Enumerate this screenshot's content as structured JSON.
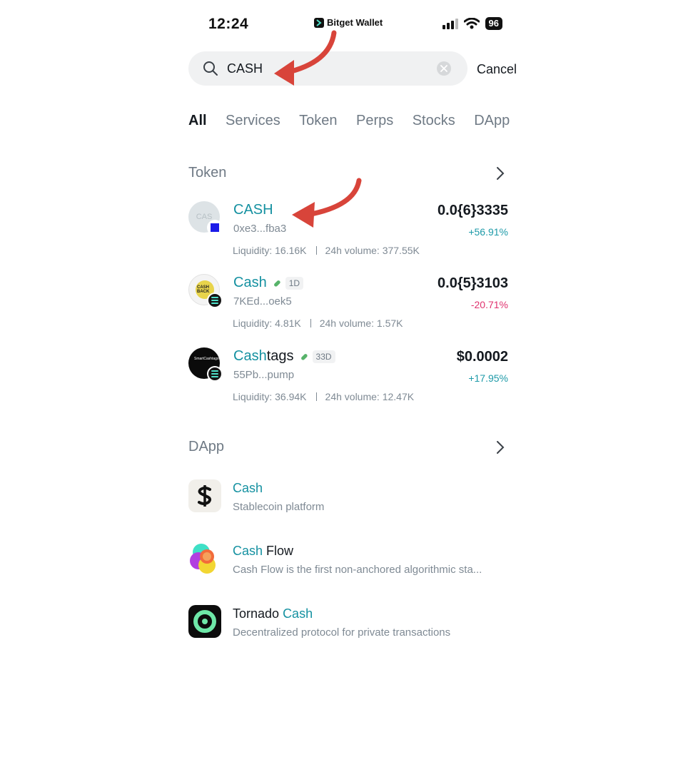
{
  "status_bar": {
    "time": "12:24",
    "app_label": "Bitget Wallet",
    "battery": "96"
  },
  "search": {
    "value": "CASH",
    "placeholder": "",
    "cancel_label": "Cancel"
  },
  "tabs": [
    {
      "label": "All",
      "active": true
    },
    {
      "label": "Services",
      "active": false
    },
    {
      "label": "Token",
      "active": false
    },
    {
      "label": "Perps",
      "active": false
    },
    {
      "label": "Stocks",
      "active": false
    },
    {
      "label": "DApp",
      "active": false
    }
  ],
  "token_section": {
    "title": "Token",
    "items": [
      {
        "name_highlight": "CASH",
        "name_rest": "",
        "age": "",
        "address": "0xe3...fba3",
        "price": "0.0{6}3335",
        "change": "+56.91%",
        "liquidity": "Liquidity: 16.16K",
        "volume": "24h volume: 377.55K",
        "avatar_text": "CAS"
      },
      {
        "name_highlight": "Cash",
        "name_rest": "",
        "age": "1D",
        "address": "7KEd...oek5",
        "price": "0.0{5}3103",
        "change": "-20.71%",
        "liquidity": "Liquidity: 4.81K",
        "volume": "24h volume: 1.57K",
        "avatar_text": "CASH BACK"
      },
      {
        "name_highlight": "Cash",
        "name_rest": "tags",
        "age": "33D",
        "address": "55Pb...pump",
        "price": "$0.0002",
        "change": "+17.95%",
        "liquidity": "Liquidity: 36.94K",
        "volume": "24h volume: 12.47K",
        "avatar_text": "SmartCashtags"
      }
    ]
  },
  "dapp_section": {
    "title": "DApp",
    "items": [
      {
        "name_prefix": "",
        "name_highlight": "Cash",
        "name_suffix": "",
        "description": "Stablecoin platform"
      },
      {
        "name_prefix": "",
        "name_highlight": "Cash",
        "name_suffix": " Flow",
        "description": "Cash Flow is the first non-anchored algorithmic sta..."
      },
      {
        "name_prefix": "Tornado ",
        "name_highlight": "Cash",
        "name_suffix": "",
        "description": "Decentralized protocol for private transactions"
      }
    ]
  },
  "colors": {
    "accent": "#1591a1",
    "positive": "#1d9aa8",
    "negative": "#e0336f",
    "annotation_arrow": "#d8443a"
  }
}
